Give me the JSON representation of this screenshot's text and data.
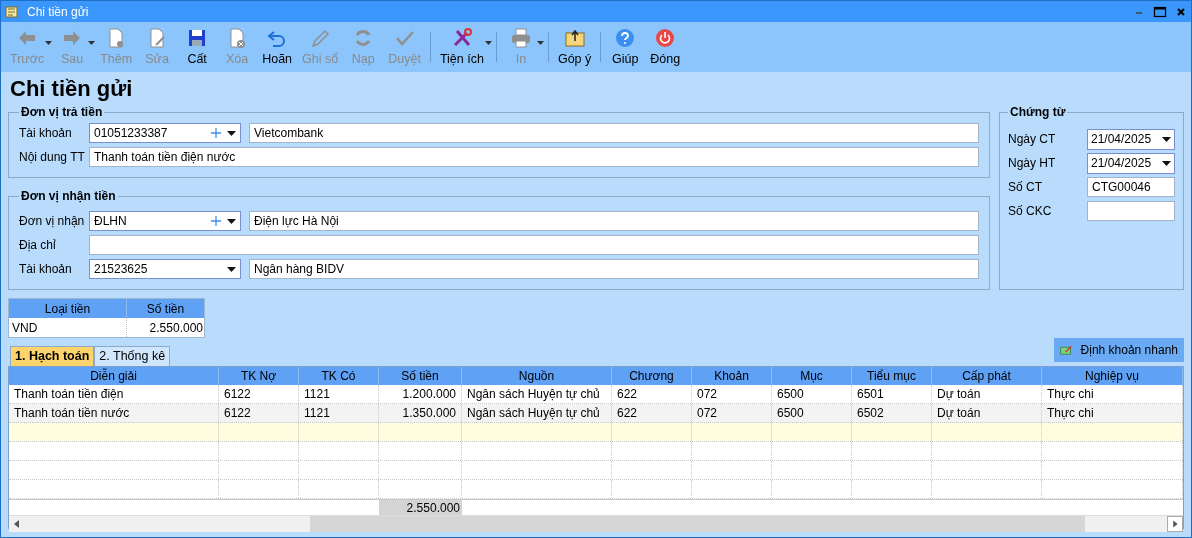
{
  "window": {
    "title": "Chi tiền gửi"
  },
  "toolbar": [
    {
      "kind": "back",
      "label": "Trước",
      "disabled": true,
      "dropdown": true
    },
    {
      "kind": "forward",
      "label": "Sau",
      "disabled": true,
      "dropdown": true
    },
    {
      "kind": "add",
      "label": "Thêm",
      "disabled": true,
      "dropdown": false
    },
    {
      "kind": "edit",
      "label": "Sửa",
      "disabled": true,
      "dropdown": false
    },
    {
      "kind": "save",
      "label": "Cất",
      "disabled": false,
      "dropdown": false
    },
    {
      "kind": "delete",
      "label": "Xóa",
      "disabled": true,
      "dropdown": false
    },
    {
      "kind": "undo",
      "label": "Hoãn",
      "disabled": false,
      "dropdown": false
    },
    {
      "kind": "pencil",
      "label": "Ghi sổ",
      "disabled": true,
      "dropdown": false
    },
    {
      "kind": "reload",
      "label": "Nạp",
      "disabled": true,
      "dropdown": false
    },
    {
      "kind": "approve",
      "label": "Duyệt",
      "disabled": true,
      "dropdown": false
    },
    {
      "kind": "separator"
    },
    {
      "kind": "tools",
      "label": "Tiện ích",
      "disabled": false,
      "dropdown": true
    },
    {
      "kind": "separator"
    },
    {
      "kind": "print",
      "label": "In",
      "disabled": true,
      "dropdown": true
    },
    {
      "kind": "separator"
    },
    {
      "kind": "feedback",
      "label": "Góp ý",
      "disabled": false,
      "dropdown": false
    },
    {
      "kind": "separator"
    },
    {
      "kind": "help",
      "label": "Giúp",
      "disabled": false,
      "dropdown": false
    },
    {
      "kind": "power",
      "label": "Đóng",
      "disabled": false,
      "dropdown": false
    }
  ],
  "heading": "Chi tiền gửi",
  "payer": {
    "title": "Đơn vị trả tiền",
    "account": {
      "label": "Tài khoản",
      "value": "01051233387",
      "name": "Vietcombank"
    },
    "content": {
      "label": "Nội dung TT",
      "value": "Thanh toán tiền điện nước"
    }
  },
  "payee": {
    "title": "Đơn vị nhận tiền",
    "unit": {
      "label": "Đơn vị nhận",
      "value": "ĐLHN",
      "name": "Điện lực Hà Nội"
    },
    "address": {
      "label": "Địa chỉ"
    },
    "account": {
      "label": "Tài khoản",
      "value": "21523625",
      "name": "Ngân hàng BIDV"
    }
  },
  "voucher": {
    "title": "Chứng từ",
    "fields": [
      {
        "kind": "date",
        "label": "Ngày CT",
        "value": "21/04/2025"
      },
      {
        "kind": "date",
        "label": "Ngày HT",
        "value": "21/04/2025"
      },
      {
        "kind": "text",
        "label": "Số CT",
        "value": "CTG00046"
      },
      {
        "kind": "text",
        "label": "Số CKC"
      }
    ]
  },
  "currency_table": {
    "columns": [
      "Loại tiền",
      "Số tiền"
    ],
    "rows": [
      [
        "VND",
        "2.550.000"
      ]
    ]
  },
  "tabs": [
    {
      "label": "1. Hạch toán",
      "selected": true
    },
    {
      "label": "2. Thống kê",
      "selected": false
    }
  ],
  "quick_entry_button": "Định khoản nhanh",
  "grid": {
    "columns": [
      "Diễn giải",
      "TK Nợ",
      "TK Có",
      "Số tiền",
      "Nguồn",
      "Chương",
      "Khoản",
      "Mục",
      "Tiểu mục",
      "Cấp phát",
      "Nghiệp vụ"
    ],
    "rows": [
      [
        "Thanh toán tiền điện",
        "6122",
        "1121",
        "1.200.000",
        "Ngân sách Huyện tự chủ",
        "622",
        "072",
        "6500",
        "6501",
        "Dự toán",
        "Thực chi"
      ],
      [
        "Thanh toán tiền nước",
        "6122",
        "1121",
        "1.350.000",
        "Ngân sách Huyện tự chủ",
        "622",
        "072",
        "6500",
        "6502",
        "Dự toán",
        "Thực chi"
      ]
    ],
    "total": "2.550.000"
  }
}
